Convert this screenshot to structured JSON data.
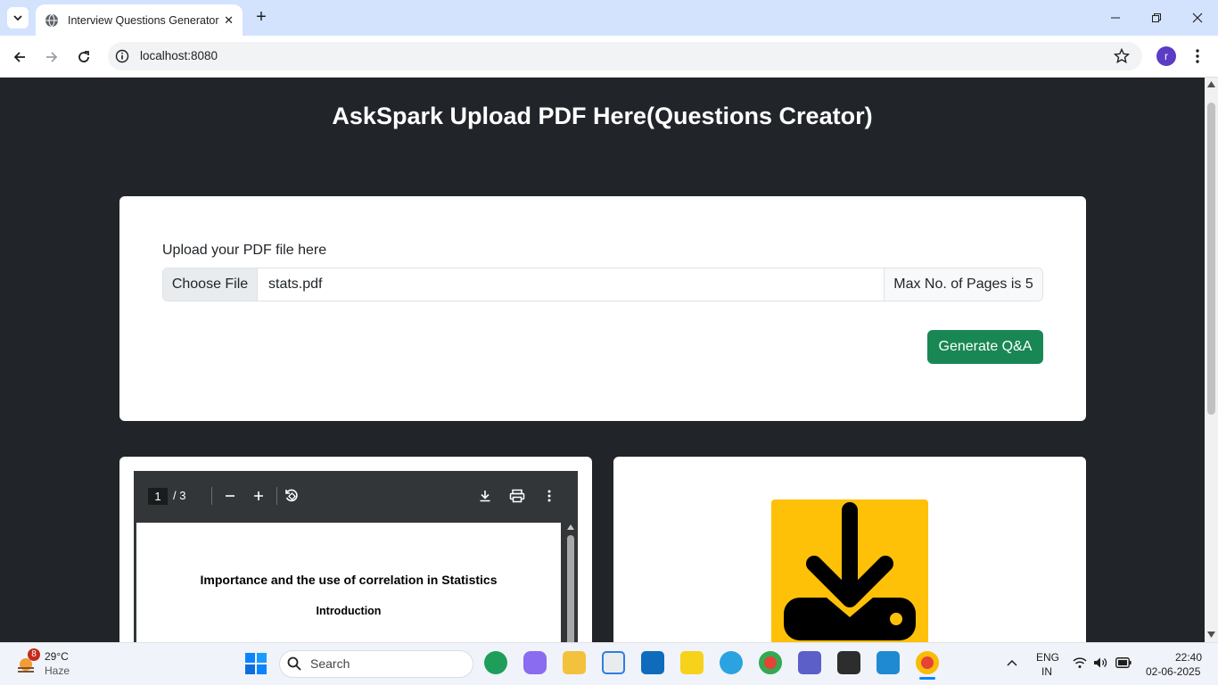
{
  "browser": {
    "tab_title": "Interview Questions Generator",
    "url": "localhost:8080",
    "avatar_letter": "r"
  },
  "page": {
    "heading": "AskSpark Upload PDF Here(Questions Creator)",
    "upload": {
      "label": "Upload your PDF file here",
      "choose_file": "Choose File",
      "file_name": "stats.pdf",
      "max_pages": "Max No. of Pages is 5",
      "generate_button": "Generate Q&A"
    },
    "pdf_viewer": {
      "current_page": "1",
      "page_total": "/  3",
      "doc_title": "Importance and the use of correlation in Statistics",
      "doc_subtitle": "Introduction"
    }
  },
  "taskbar": {
    "weather_badge": "8",
    "weather_temp": "29°C",
    "weather_desc": "Haze",
    "search_placeholder": "Search",
    "lang_line1": "ENG",
    "lang_line2": "IN",
    "time": "22:40",
    "date": "02-06-2025"
  },
  "colors": {
    "page_bg": "#212529",
    "generate_button": "#198754",
    "download_image_bg": "#ffc107"
  }
}
